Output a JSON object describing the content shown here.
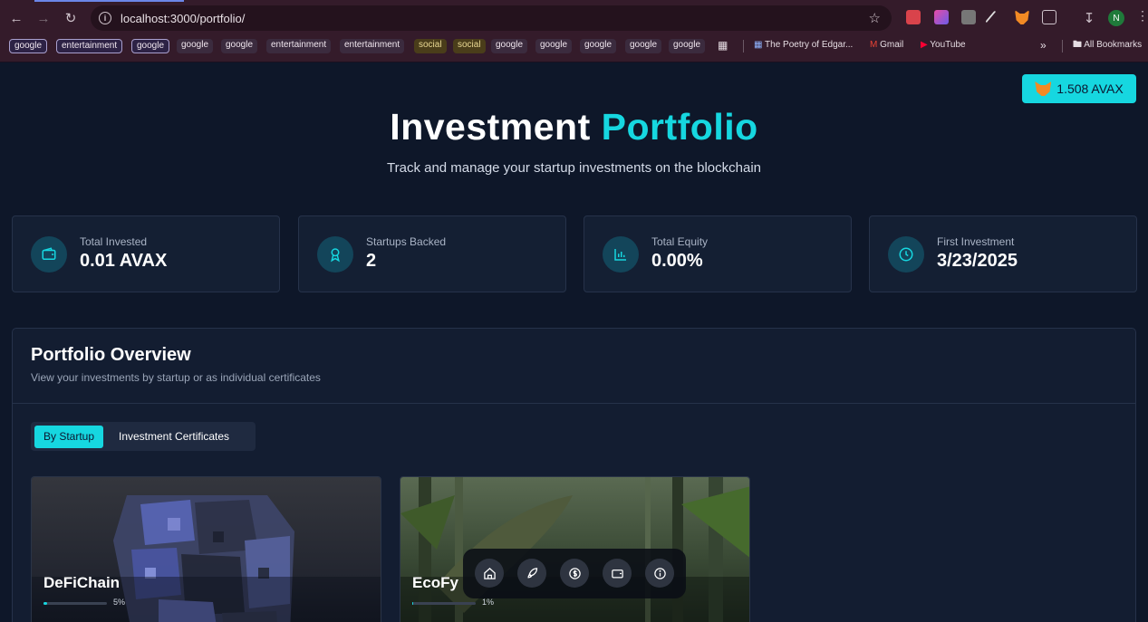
{
  "browser": {
    "url": "localhost:3000/portfolio/",
    "profile_initial": "N",
    "bookmarks": [
      {
        "label": "google",
        "style": "outlined"
      },
      {
        "label": "entertainment",
        "style": "outlined"
      },
      {
        "label": "google",
        "style": "outlined"
      },
      {
        "label": "google",
        "style": "filled"
      },
      {
        "label": "google",
        "style": "filled"
      },
      {
        "label": "entertainment",
        "style": "filled"
      },
      {
        "label": "entertainment",
        "style": "filled"
      },
      {
        "label": "social",
        "style": "social"
      },
      {
        "label": "social",
        "style": "social"
      },
      {
        "label": "google",
        "style": "filled"
      },
      {
        "label": "google",
        "style": "filled"
      },
      {
        "label": "google",
        "style": "filled"
      },
      {
        "label": "google",
        "style": "filled"
      },
      {
        "label": "google",
        "style": "filled"
      }
    ],
    "bookmark_links": {
      "poetry": "The Poetry of Edgar...",
      "gmail": "Gmail",
      "youtube": "YouTube",
      "overflow": "»",
      "all": "All Bookmarks"
    }
  },
  "wallet": {
    "balance": "1.508 AVAX"
  },
  "hero": {
    "title_main": "Investment",
    "title_accent": "Portfolio",
    "subtitle": "Track and manage your startup investments on the blockchain"
  },
  "stats": [
    {
      "label": "Total Invested",
      "value": "0.01 AVAX",
      "icon": "wallet-icon"
    },
    {
      "label": "Startups Backed",
      "value": "2",
      "icon": "award-icon"
    },
    {
      "label": "Total Equity",
      "value": "0.00%",
      "icon": "bar-chart-icon"
    },
    {
      "label": "First Investment",
      "value": "3/23/2025",
      "icon": "clock-icon"
    }
  ],
  "overview": {
    "title": "Portfolio Overview",
    "subtitle": "View your investments by startup or as individual certificates",
    "tabs": {
      "by_startup": "By Startup",
      "certificates": "Investment Certificates"
    }
  },
  "startups": [
    {
      "name": "DeFiChain",
      "percent": "5%",
      "progress": 0.05
    },
    {
      "name": "EcoFy",
      "percent": "1%",
      "progress": 0.01
    }
  ],
  "colors": {
    "accent": "#16d7e0",
    "background": "#0e1729",
    "card": "#141f33"
  }
}
